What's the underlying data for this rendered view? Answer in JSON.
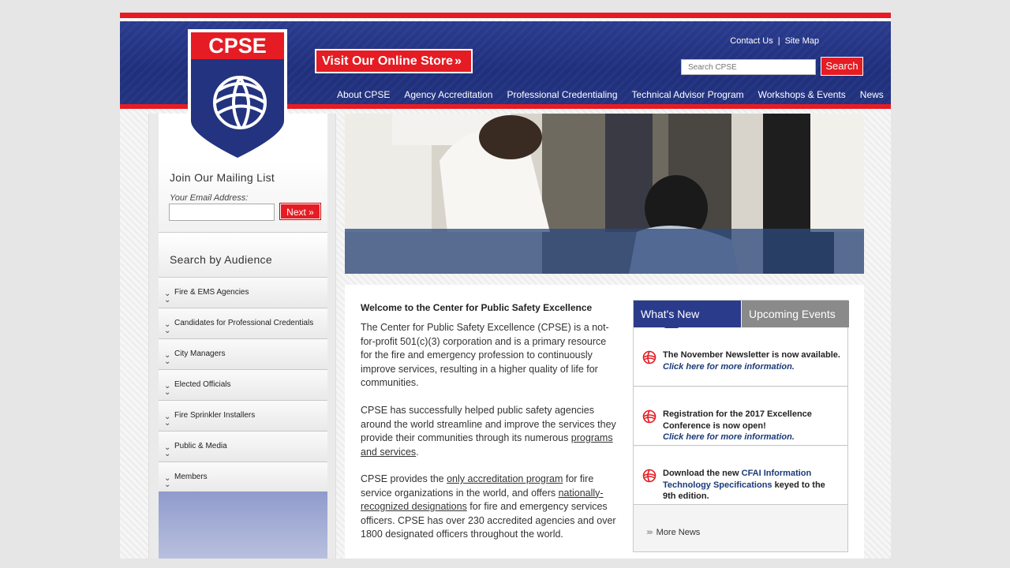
{
  "brand": {
    "logo_text": "CPSE",
    "red": "#e51c23",
    "blue": "#23337f"
  },
  "header": {
    "store_button": "Visit Our Online Store",
    "contact_link": "Contact Us",
    "separator": "|",
    "sitemap_link": "Site Map",
    "search_placeholder": "Search CPSE",
    "search_button": "Search",
    "nav": [
      "About CPSE",
      "Agency Accreditation",
      "Professional Credentialing",
      "Technical Advisor Program",
      "Workshops & Events",
      "News"
    ]
  },
  "sidebar": {
    "mailing_title": "Join Our Mailing List",
    "email_label": "Your Email Address:",
    "email_value": "",
    "next_button": "Next »",
    "audience_title": "Search by Audience",
    "audience": [
      "Fire & EMS Agencies",
      "Candidates for Professional Credentials",
      "City Managers",
      "Elected Officials",
      "Fire Sprinkler Installers",
      "Public & Media",
      "Members"
    ]
  },
  "main": {
    "welcome_title": "Welcome to the Center for Public Safety Excellence",
    "p1": "The Center for Public Safety Excellence (CPSE) is a not-for-profit 501(c)(3) corporation and is a primary resource for the fire and emergency profession to continuously improve services, resulting in a higher quality of life for communities.",
    "p2_pre": "CPSE has successfully helped public safety agencies around the world streamline and improve the services they provide their communities through its numerous ",
    "p2_link": "programs and services",
    "p2_post": ".",
    "p3_pre": "CPSE provides the ",
    "p3_link1": "only accreditation program",
    "p3_mid": " for fire service organizations in the world, and offers ",
    "p3_link2": "nationally-recognized designations",
    "p3_post": " for fire and emergency services officers. CPSE has over 230 accredited agencies and over 1800 designated officers throughout the world."
  },
  "news": {
    "tab_new": "What's New",
    "tab_events": "Upcoming Events",
    "items": [
      {
        "text": "The November Newsletter is now available.",
        "link": "Click here for more information."
      },
      {
        "text": "Registration for the 2017 Excellence Conference is now open!",
        "link": "Click here for more information."
      },
      {
        "pre": "Download the new ",
        "highlight": "CFAI Information Technology Specifications",
        "post": " keyed to the 9th edition."
      }
    ],
    "more": "More News"
  }
}
